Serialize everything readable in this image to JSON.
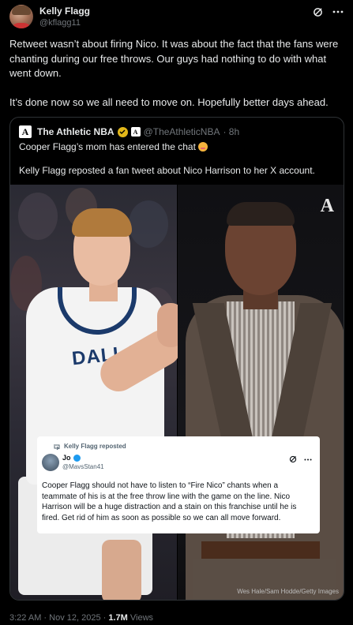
{
  "post": {
    "author_name": "Kelly Flagg",
    "author_handle": "@kflagg11",
    "paragraph_1": "Retweet wasn’t about firing Nico. It was about the fact that the fans were chanting during our free throws. Our guys had nothing to do with what went down.",
    "paragraph_2": "It’s done now so we all need to move on. Hopefully better days ahead."
  },
  "quote": {
    "logo_letter": "A",
    "name": "The Athletic NBA",
    "handle": "@TheAthleticNBA",
    "time": "· 8h",
    "line_1": "Cooper Flagg’s mom has entered the chat",
    "line_2": "Kelly Flagg reposted a fan tweet about Nico Harrison to her X account.",
    "image": {
      "watermark": "A",
      "jersey_text": "DALLAS",
      "credit": "Wes Hale/Sam Hodde/Getty Images"
    }
  },
  "repost_card": {
    "repost_label": "Kelly Flagg reposted",
    "name": "Jo",
    "handle": "@MavsStan41",
    "text": "Cooper Flagg should not have to listen to “Fire Nico” chants when a teammate of his is at the free throw line with the game on the line. Nico Harrison will be a huge distraction and a stain on this franchise until he is fired. Get rid of him as soon as possible so we can all move forward."
  },
  "footer": {
    "timestamp": "3:22 AM · Nov 12, 2025 · ",
    "views_count": "1.7M",
    "views_label": " Views"
  },
  "colors": {
    "background": "#000000",
    "text": "#e7e9ea",
    "muted": "#71767b",
    "border": "#2f3336",
    "verified_gold": "#e2b719",
    "verified_blue": "#1d9bf0"
  },
  "icons": [
    "grok-icon",
    "more-icon",
    "verified-gold-icon",
    "affiliate-badge-icon",
    "repost-icon",
    "smile-emoji-icon"
  ]
}
